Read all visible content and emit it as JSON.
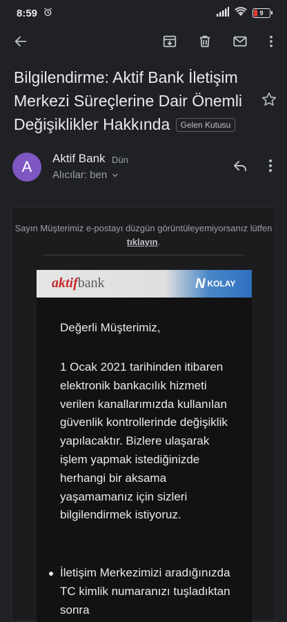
{
  "status_bar": {
    "time": "8:59",
    "battery": "9"
  },
  "toolbar": {
    "back_icon": "arrow-left-icon",
    "archive_icon": "archive-icon",
    "delete_icon": "trash-icon",
    "mark_unread_icon": "mail-icon",
    "more_icon": "more-vert-icon"
  },
  "email": {
    "subject": "Bilgilendirme: Aktif Bank İletişim Merkezi Süreçlerine Dair Önemli Değişiklikler Hakkında",
    "label": "Gelen Kutusu",
    "sender": {
      "avatar_letter": "A",
      "avatar_color": "#7e57c2",
      "name": "Aktif Bank",
      "date": "Dün"
    },
    "recipients": "Alıcılar: ben",
    "body": {
      "notice": "Sayın Müşterimiz e-postayı düzgün görüntüleyemiyorsanız lütfen",
      "notice_link": "tıklayın",
      "notice_end": ".",
      "logo_left_a": "aktif",
      "logo_left_b": "bank",
      "logo_right_n": "N",
      "logo_right_text": "KOLAY",
      "greeting": "Değerli Müşterimiz,",
      "paragraph": "1 Ocak 2021 tarihinden itibaren elektronik bankacılık hizmeti verilen kanallarımızda kullanılan güvenlik kontrollerinde değişiklik yapılacaktır. Bizlere ulaşarak işlem yapmak istediğinizde herhangi bir aksama yaşamamanız için sizleri bilgilendirmek istiyoruz.",
      "bullet_1": "İletişim Merkezimizi aradığınızda TC kimlik numaranızı tuşladıktan sonra"
    }
  }
}
